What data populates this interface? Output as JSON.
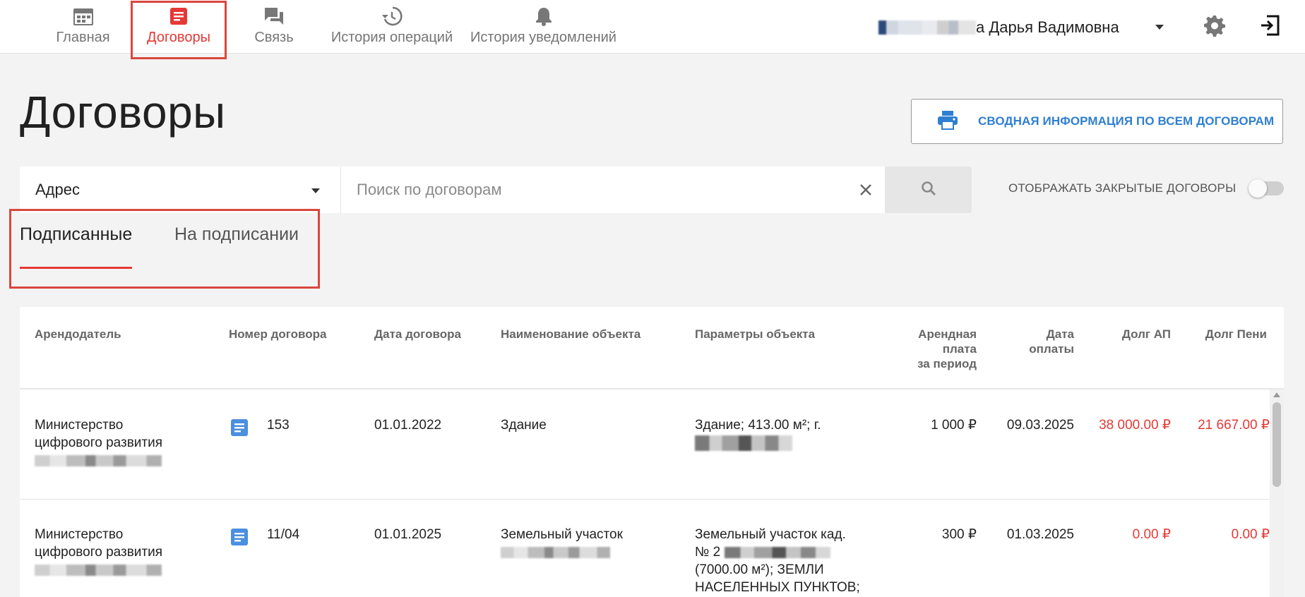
{
  "nav": {
    "items": [
      {
        "label": "Главная",
        "icon": "calendar-icon"
      },
      {
        "label": "Договоры",
        "icon": "document-icon",
        "active": true
      },
      {
        "label": "Связь",
        "icon": "chat-icon"
      },
      {
        "label": "История операций",
        "icon": "history-icon"
      },
      {
        "label": "История уведомлений",
        "icon": "bell-icon"
      }
    ],
    "user_name": "а Дарья Вадимовна"
  },
  "page": {
    "title": "Договоры",
    "summary_button": "СВОДНАЯ ИНФОРМАЦИЯ ПО ВСЕМ ДОГОВОРАМ"
  },
  "filters": {
    "address_select": "Адрес",
    "search_placeholder": "Поиск по договорам",
    "show_closed_label": "ОТОБРАЖАТЬ ЗАКРЫТЫЕ ДОГОВОРЫ",
    "show_closed": false
  },
  "tabs": [
    {
      "label": "Подписанные",
      "active": true
    },
    {
      "label": "На подписании",
      "active": false
    }
  ],
  "table": {
    "headers": {
      "landlord": "Арендодатель",
      "number": "Номер договора",
      "date": "Дата договора",
      "object_name": "Наименование объекта",
      "object_params": "Параметры объекта",
      "rent_1": "Арендная",
      "rent_2": "плата",
      "rent_3": "за период",
      "paydate_1": "Дата",
      "paydate_2": "оплаты",
      "debt_ap": "Долг АП",
      "debt_peni": "Долг Пени"
    },
    "rows": [
      {
        "landlord_1": "Министерство",
        "landlord_2": "цифрового развития",
        "number": "153",
        "date": "01.01.2022",
        "object_name": "Здание",
        "params_1": "Здание; 413.00 м²; г.",
        "rent": "1 000 ₽",
        "paydate": "09.03.2025",
        "debt_ap": "38 000.00 ₽",
        "debt_peni": "21 667.00 ₽"
      },
      {
        "landlord_1": "Министерство",
        "landlord_2": "цифрового развития",
        "number": "11/04",
        "date": "01.01.2025",
        "object_name": "Земельный участок",
        "params_1": "Земельный участок кад.",
        "params_2": "№ 2",
        "params_3": "(7000.00 м²); ЗЕМЛИ",
        "params_4": "НАСЕЛЕННЫХ ПУНКТОВ;",
        "rent": "300 ₽",
        "paydate": "01.03.2025",
        "debt_ap": "0.00 ₽",
        "debt_peni": "0.00 ₽"
      }
    ]
  },
  "colors": {
    "accent_red": "#e53935",
    "link_blue": "#2f7fd1",
    "doc_icon_blue": "#4a8fe0"
  }
}
